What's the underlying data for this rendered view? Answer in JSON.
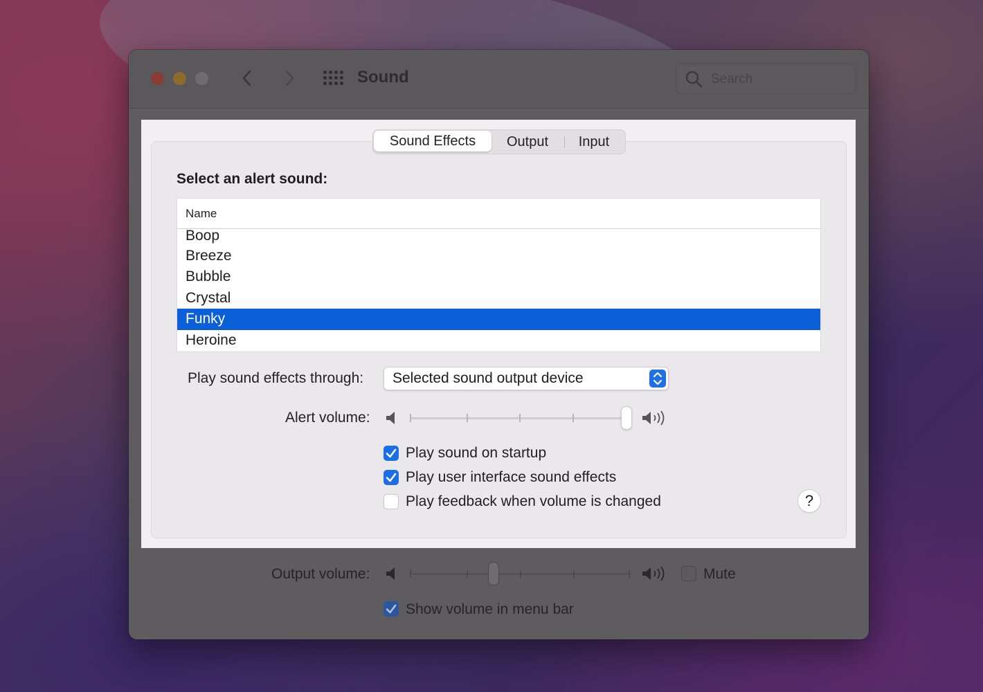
{
  "window": {
    "title": "Sound",
    "search": {
      "placeholder": "Search"
    }
  },
  "tabs": [
    {
      "label": "Sound Effects",
      "active": true
    },
    {
      "label": "Output",
      "active": false
    },
    {
      "label": "Input",
      "active": false
    }
  ],
  "sound_effects": {
    "select_label": "Select an alert sound:",
    "table": {
      "column": "Name",
      "rows": [
        "Boop",
        "Breeze",
        "Bubble",
        "Crystal",
        "Funky",
        "Heroine"
      ],
      "selected": "Funky"
    },
    "play_through": {
      "label": "Play sound effects through:",
      "value": "Selected sound output device"
    },
    "alert_volume": {
      "label": "Alert volume:",
      "level": 1.0
    },
    "checkboxes": [
      {
        "label": "Play sound on startup",
        "checked": true
      },
      {
        "label": "Play user interface sound effects",
        "checked": true
      },
      {
        "label": "Play feedback when volume is changed",
        "checked": false
      }
    ],
    "help": "?"
  },
  "output": {
    "volume": {
      "label": "Output volume:",
      "level": 0.38
    },
    "mute": {
      "label": "Mute",
      "checked": false
    },
    "show_in_menu_bar": {
      "label": "Show volume in menu bar",
      "checked": true
    }
  },
  "colors": {
    "accent": "#0b5fd8",
    "checkbox": "#1a6ee6"
  },
  "icons": {
    "close": "close-icon",
    "minimize": "minimize-icon",
    "zoom": "zoom-icon",
    "back": "chevron-left-icon",
    "forward": "chevron-right-icon",
    "grid": "grid-icon",
    "search": "search-icon",
    "speaker_low": "speaker-low-icon",
    "speaker_high": "speaker-high-icon"
  }
}
